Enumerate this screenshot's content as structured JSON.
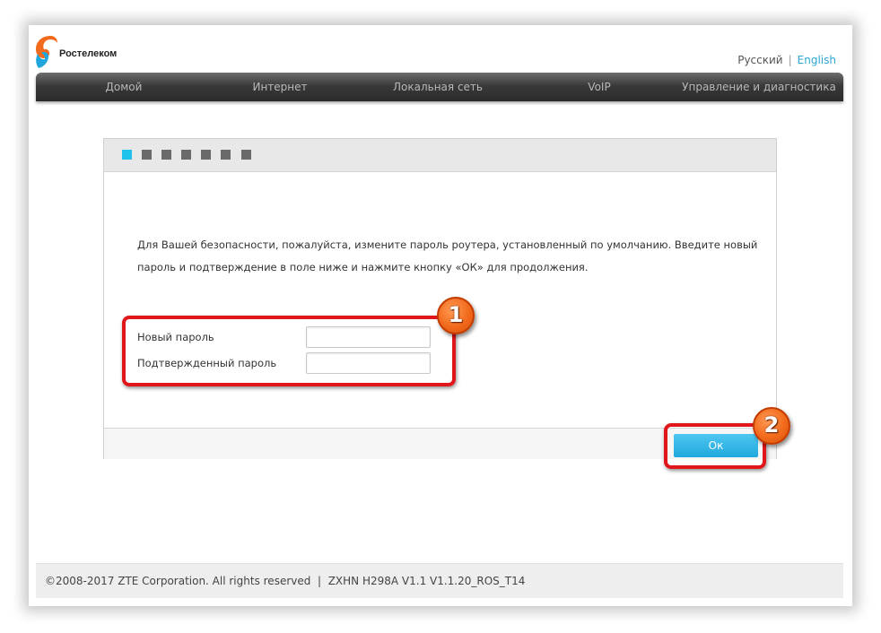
{
  "brand": {
    "name": "Ростелеком",
    "colors": {
      "orange": "#f26a1b",
      "blue": "#1fa6dc"
    }
  },
  "language": {
    "russian": "Русский",
    "separator": "|",
    "english": "English",
    "active": "Русский"
  },
  "nav": {
    "items": [
      {
        "label": "Домой"
      },
      {
        "label": "Интернет"
      },
      {
        "label": "Локальная сеть"
      },
      {
        "label": "VoIP"
      },
      {
        "label": "Управление и диагностика"
      }
    ]
  },
  "wizard": {
    "steps_total": 7,
    "active_step": 1,
    "description": "Для Вашей безопасности, пожалуйста, измените пароль роутера, установленный по умолчанию. Введите новый пароль и подтверждение в поле ниже и нажмите кнопку «ОК» для продолжения.",
    "fields": [
      {
        "label": "Новый пароль",
        "value": ""
      },
      {
        "label": "Подтвержденный пароль",
        "value": ""
      }
    ],
    "ok_label": "Ок"
  },
  "annotations": [
    {
      "number": "1"
    },
    {
      "number": "2"
    }
  ],
  "footer": {
    "copyright": "©2008-2017 ZTE Corporation. All rights reserved",
    "separator": "|",
    "version": "ZXHN H298A V1.1 V1.1.20_ROS_T14"
  }
}
